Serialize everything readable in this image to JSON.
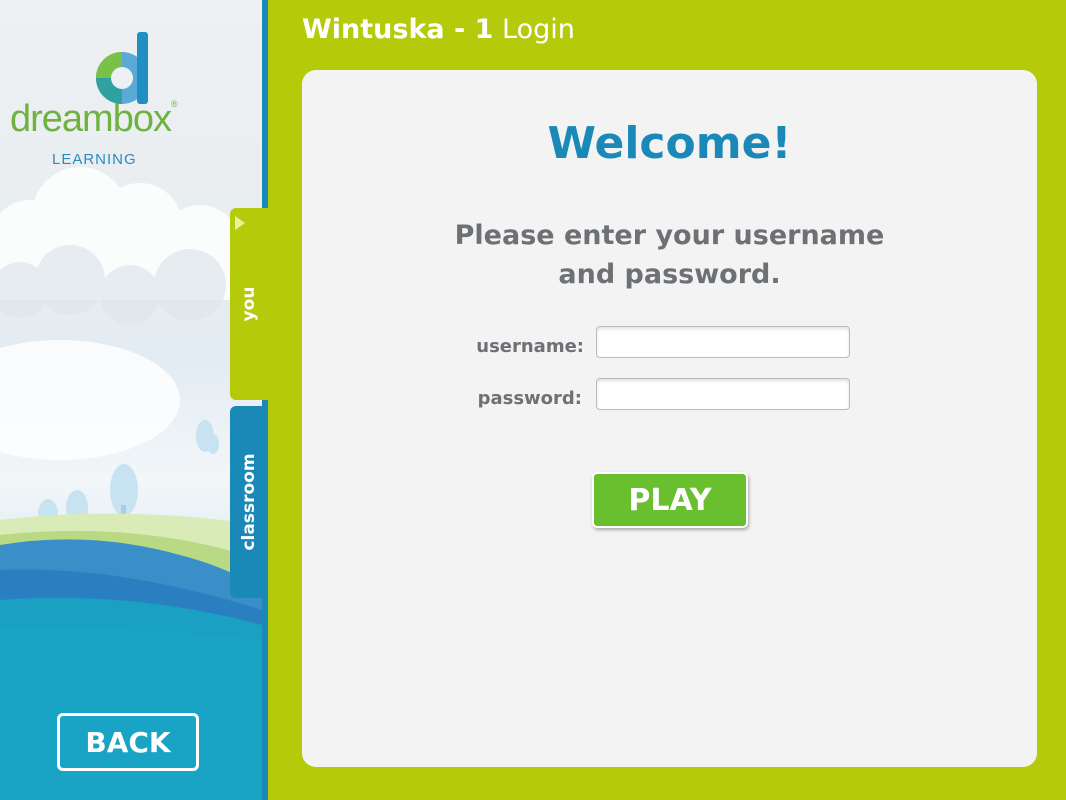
{
  "header": {
    "app_name": "Wintuska - 1",
    "page": "Login"
  },
  "logo": {
    "name": "dreambox",
    "registered": "®",
    "tagline": "LEARNING"
  },
  "tabs": [
    {
      "label": "you",
      "active": true
    },
    {
      "label": "classroom",
      "active": false
    }
  ],
  "back_button": "BACK",
  "login": {
    "welcome": "Welcome!",
    "instruction_line1": "Please enter your username",
    "instruction_line2": "and password.",
    "username_label": "username:",
    "username_value": "",
    "password_label": "password:",
    "password_value": "",
    "play_button": "PLAY"
  },
  "colors": {
    "brand_green": "#b4ca0a",
    "brand_blue": "#1a89b8",
    "play_green": "#6abf2e",
    "panel_bg": "#f2f3f2",
    "text_gray": "#6d7074"
  }
}
